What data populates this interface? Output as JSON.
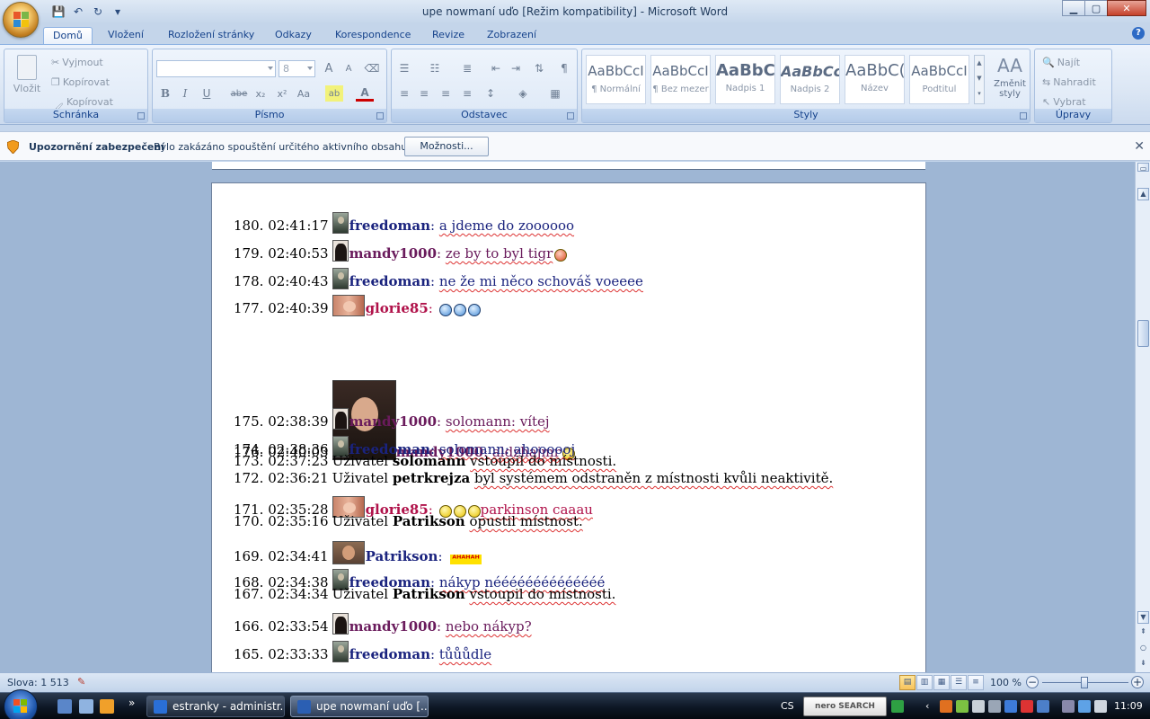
{
  "window": {
    "title": "upe nowmaní uďo [Režim kompatibility] - Microsoft Word",
    "minimize": "▁",
    "maximize": "▢",
    "close": "✕"
  },
  "qat": {
    "save": "💾",
    "undo": "↶",
    "redo": "↻",
    "more": "▾"
  },
  "tabs": [
    "Domů",
    "Vložení",
    "Rozložení stránky",
    "Odkazy",
    "Korespondence",
    "Revize",
    "Zobrazení"
  ],
  "help": "?",
  "ribbon": {
    "clipboard": {
      "label": "Schránka",
      "paste": "Vložit",
      "cut": "Vyjmout",
      "copy": "Kopírovat",
      "format_painter": "Kopírovat formát"
    },
    "font": {
      "label": "Písmo",
      "font_name": "",
      "font_size": "8",
      "bold": "B",
      "italic": "I",
      "underline": "U",
      "strike": "abe",
      "subscript": "x₂",
      "superscript": "x²",
      "case": "Aa",
      "grow": "A",
      "shrink": "A"
    },
    "paragraph": {
      "label": "Odstavec"
    },
    "styles": {
      "label": "Styly",
      "items": [
        {
          "preview": "AaBbCcI",
          "name": "¶ Normální"
        },
        {
          "preview": "AaBbCcI",
          "name": "¶ Bez mezer"
        },
        {
          "preview": "AaBbC(",
          "name": "Nadpis 1"
        },
        {
          "preview": "AaBbCc",
          "name": "Nadpis 2"
        },
        {
          "preview": "AaBbC(",
          "name": "Název"
        },
        {
          "preview": "AaBbCcI",
          "name": "Podtitul"
        }
      ],
      "change": "Změnit styly",
      "change_icon": "AA"
    },
    "editing": {
      "label": "Úpravy",
      "find": "Najít",
      "replace": "Nahradit",
      "select": "Vybrat"
    }
  },
  "security": {
    "title": "Upozornění zabezpečení",
    "message": "Bylo zakázáno spouštění určitého aktivního obsahu.",
    "button": "Možnosti...",
    "close": "✕"
  },
  "chat": [
    {
      "num": "180.",
      "time": "02:41:17",
      "type": "msg",
      "avatar": "freedoman",
      "nick": "freedoman",
      "color": "blue",
      "text": "a jdeme do zoooooo"
    },
    {
      "num": "179.",
      "time": "02:40:53",
      "type": "msg",
      "avatar": "mandy",
      "nick": "mandy1000",
      "color": "purple",
      "text": "ze by to byl tigr"
    },
    {
      "num": "178.",
      "time": "02:40:43",
      "type": "msg",
      "avatar": "freedoman",
      "nick": "freedoman",
      "color": "blue",
      "text": "ne že mi něco schováš voeeee"
    },
    {
      "num": "177.",
      "time": "02:40:39",
      "type": "msg",
      "avatar": "glorie",
      "nick": "glorie85",
      "color": "red",
      "text": ""
    },
    {
      "num": "176.",
      "time": "02:40:03",
      "type": "msg",
      "avatar": "bigphoto",
      "nick": "mandy1000",
      "color": "purple",
      "text": "aldzhajmr"
    },
    {
      "num": "175.",
      "time": "02:38:39",
      "type": "msg",
      "avatar": "mandy",
      "nick": "mandy1000",
      "color": "purple",
      "text": "solomann: vítej"
    },
    {
      "num": "174.",
      "time": "02:38:36",
      "type": "msg",
      "avatar": "freedoman",
      "nick": "freedoman",
      "color": "blue",
      "text": "solomann: ahoooooj"
    },
    {
      "num": "173.",
      "time": "02:37:23",
      "type": "sys",
      "pre": "Uživatel",
      "user": "solomann",
      "post": "vstoupil do místnosti."
    },
    {
      "num": "172.",
      "time": "02:36:21",
      "type": "sys",
      "pre": "Uživatel",
      "user": "petrkrejza",
      "post": "byl systémem odstraněn z místnosti kvůli neaktivitě."
    },
    {
      "num": "171.",
      "time": "02:35:28",
      "type": "msg",
      "avatar": "glorie",
      "nick": "glorie85",
      "color": "red",
      "text": "parkinson caaau"
    },
    {
      "num": "170.",
      "time": "02:35:16",
      "type": "sys",
      "pre": "Uživatel",
      "user": "Patrikson",
      "post": "opustil místnost."
    },
    {
      "num": "169.",
      "time": "02:34:41",
      "type": "msg",
      "avatar": "patrikson",
      "nick": "Patrikson",
      "color": "blue",
      "text": ""
    },
    {
      "num": "168.",
      "time": "02:34:38",
      "type": "msg",
      "avatar": "freedoman",
      "nick": "freedoman",
      "color": "blue",
      "text": "nákyp néééééééééééééé"
    },
    {
      "num": "167.",
      "time": "02:34:34",
      "type": "sys",
      "pre": "Uživatel",
      "user": "Patrikson",
      "post": "vstoupil do místnosti."
    },
    {
      "num": "166.",
      "time": "02:33:54",
      "type": "msg",
      "avatar": "mandy",
      "nick": "mandy1000",
      "color": "purple",
      "text": "nebo nákyp?"
    },
    {
      "num": "165.",
      "time": "02:33:33",
      "type": "msg",
      "avatar": "freedoman",
      "nick": "freedoman",
      "color": "blue",
      "text": "tůůůdle"
    }
  ],
  "laugh_text": "ᴬᴴᴬᴴᴬᴴ",
  "status": {
    "words": "Slova: 1 513",
    "zoom": "100 %",
    "zoom_minus": "−",
    "zoom_plus": "+"
  },
  "taskbar": {
    "items": [
      {
        "label": "estranky - administr..."
      },
      {
        "label": "upe nowmaní uďo [..."
      }
    ],
    "lang": "CS",
    "nero": "nero SEARCH",
    "clock": "11:09"
  }
}
